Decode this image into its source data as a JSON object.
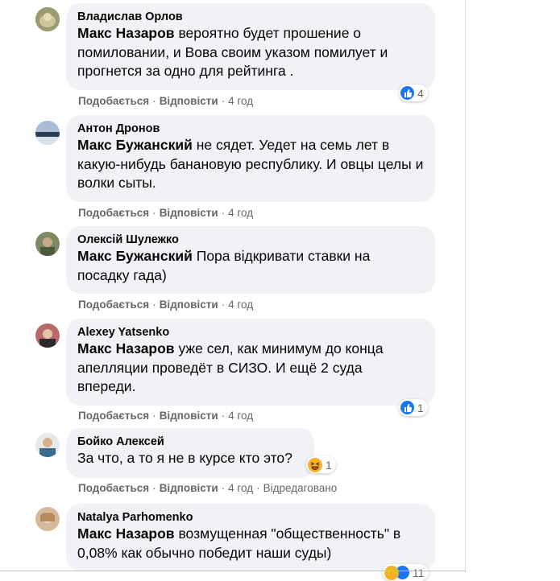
{
  "action_like": "Подобається",
  "action_reply": "Відповісти",
  "comments": [
    {
      "author": "Владислав Орлов",
      "mention": "Макс Назаров",
      "text": " вероятно будет прошение о помиловании, и Вова своим указом помилует и прогнется за одно для рейтинга .",
      "time": "4 год",
      "reaction_icon": "like-icon",
      "reaction_count": "4"
    },
    {
      "author": "Антон Дронов",
      "mention": "Макс Бужанский",
      "text": " не сядет. Уедет на семь лет в какую-нибудь банановую республику. И овцы целы и волки сыты.",
      "time": "4 год"
    },
    {
      "author": "Олексій Шулежко",
      "mention": "Макс Бужанский",
      "text": " Пора відкривати ставки на посадку гада)",
      "time": "4 год"
    },
    {
      "author": "Alexey Yatsenko",
      "mention": "Макс Назаров",
      "text": " уже сел, как минимум до конца апелляции проведёт в СИЗО. И ещё 2 суда впереди.",
      "time": "4 год",
      "reaction_icon": "like-icon",
      "reaction_count": "1"
    },
    {
      "author": "Бойко Алексей",
      "mention": "",
      "text": "За что, а то я не в курсе кто это?",
      "time": "4 год",
      "edited": "Відредаговано",
      "reaction_icon": "haha-icon",
      "reaction_count": "1"
    },
    {
      "author": "Natalya Parhomenko",
      "mention": "Макс Назаров",
      "text": " возмущенная \"общественность\" в 0,08% как обычно победит наши суды)",
      "time": "",
      "reaction_count": "11"
    }
  ]
}
